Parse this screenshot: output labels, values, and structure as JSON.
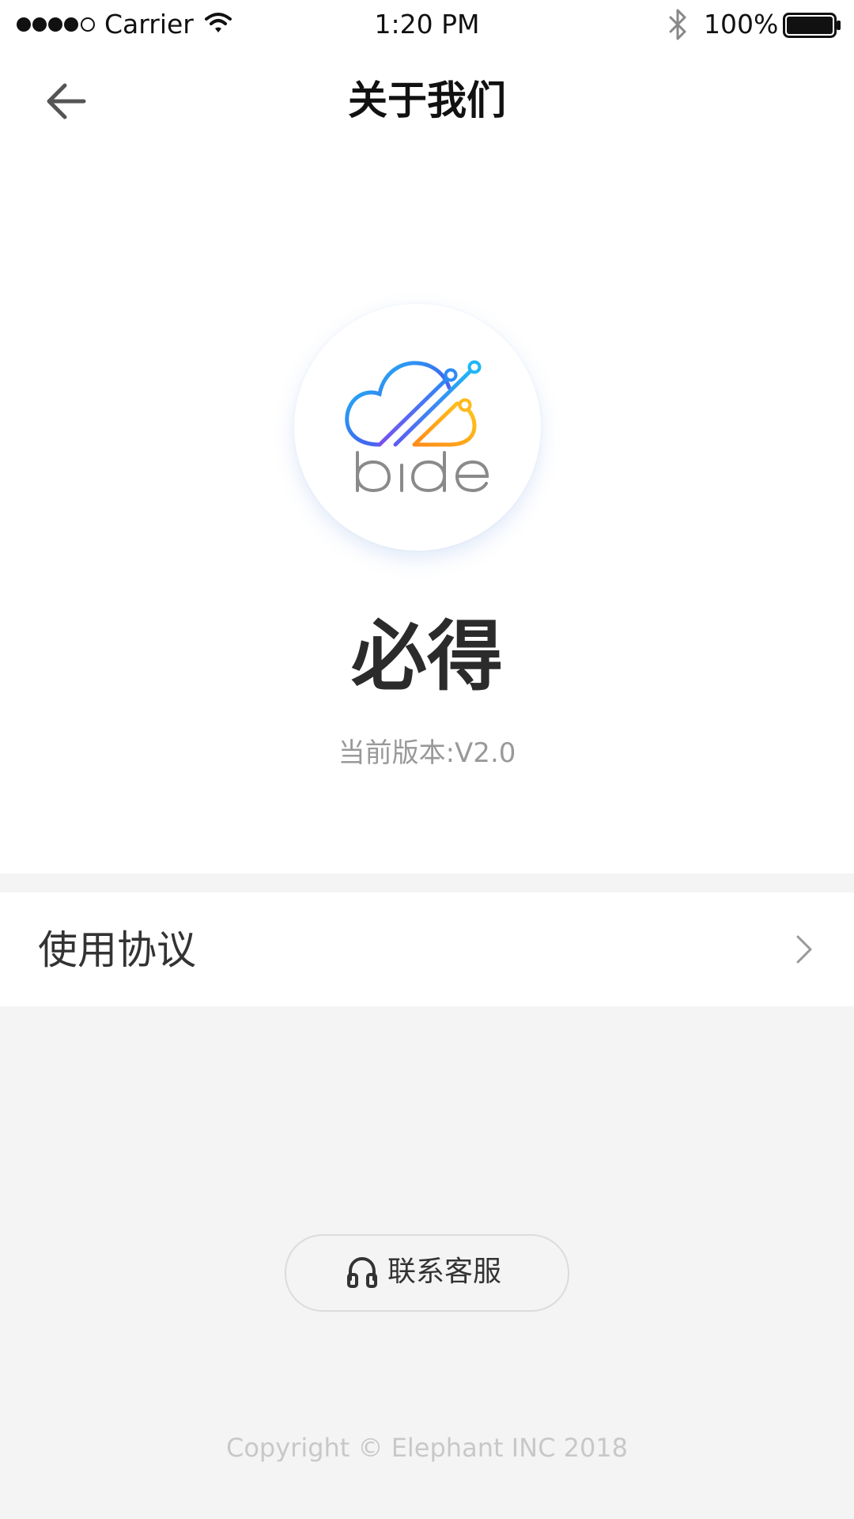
{
  "status_bar": {
    "carrier": "Carrier",
    "time": "1:20 PM",
    "battery_percent": "100%",
    "signal_icon": "signal-dots-icon",
    "wifi_icon": "wifi-icon",
    "bluetooth_icon": "bluetooth-icon",
    "battery_icon": "battery-icon",
    "battery_level": 1.0
  },
  "nav": {
    "title": "关于我们",
    "back_icon": "arrow-left-icon"
  },
  "app": {
    "logo_text": "bide",
    "name": "必得",
    "version": "当前版本:V2.0"
  },
  "menu": {
    "items": [
      {
        "label": "使用协议",
        "icon": "chevron-right-icon"
      }
    ]
  },
  "contact": {
    "label": "联系客服",
    "icon": "headset-icon"
  },
  "footer": {
    "copyright": "Copyright © Elephant INC 2018"
  },
  "colors": {
    "background": "#f4f4f4",
    "surface": "#ffffff",
    "text_primary": "#333333",
    "text_secondary": "#999999",
    "text_muted": "#c8c8c8",
    "logo_blue": "#1fb6f5",
    "logo_purple": "#7a4ff0",
    "logo_orange": "#ff9f1a"
  }
}
